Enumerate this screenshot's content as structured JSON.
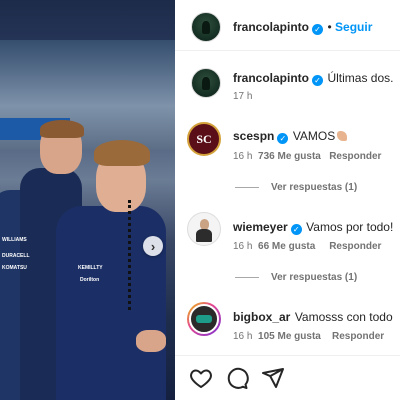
{
  "post": {
    "author": "francolapinto",
    "follow_label": "Seguir",
    "caption": "Últimas dos.",
    "caption_time": "17 h"
  },
  "photo": {
    "logos": [
      "WILLIAMS",
      "DURACELL",
      "KOMATSU",
      "KEMILLTY",
      "Dorilton"
    ]
  },
  "comments": [
    {
      "user": "scespn",
      "text": "VAMOS",
      "time": "16 h",
      "likes": "736 Me gusta",
      "reply": "Responder",
      "view_replies": "Ver respuestas (1)"
    },
    {
      "user": "wiemeyer",
      "text": "Vamos por todo!",
      "time": "16 h",
      "likes": "66 Me gusta",
      "reply": "Responder",
      "view_replies": "Ver respuestas (1)"
    },
    {
      "user": "bigbox_ar",
      "text": "Vamosss con todo",
      "time": "16 h",
      "likes": "105 Me gusta",
      "reply": "Responder"
    }
  ],
  "avatar_labels": {
    "scespn": "SC"
  },
  "colors": {
    "link": "#0095f6",
    "verified": "#0095f6",
    "text": "#262626",
    "muted": "#737373"
  },
  "icons": [
    "heart-icon",
    "comment-icon",
    "share-icon",
    "verified-icon",
    "next-icon"
  ]
}
